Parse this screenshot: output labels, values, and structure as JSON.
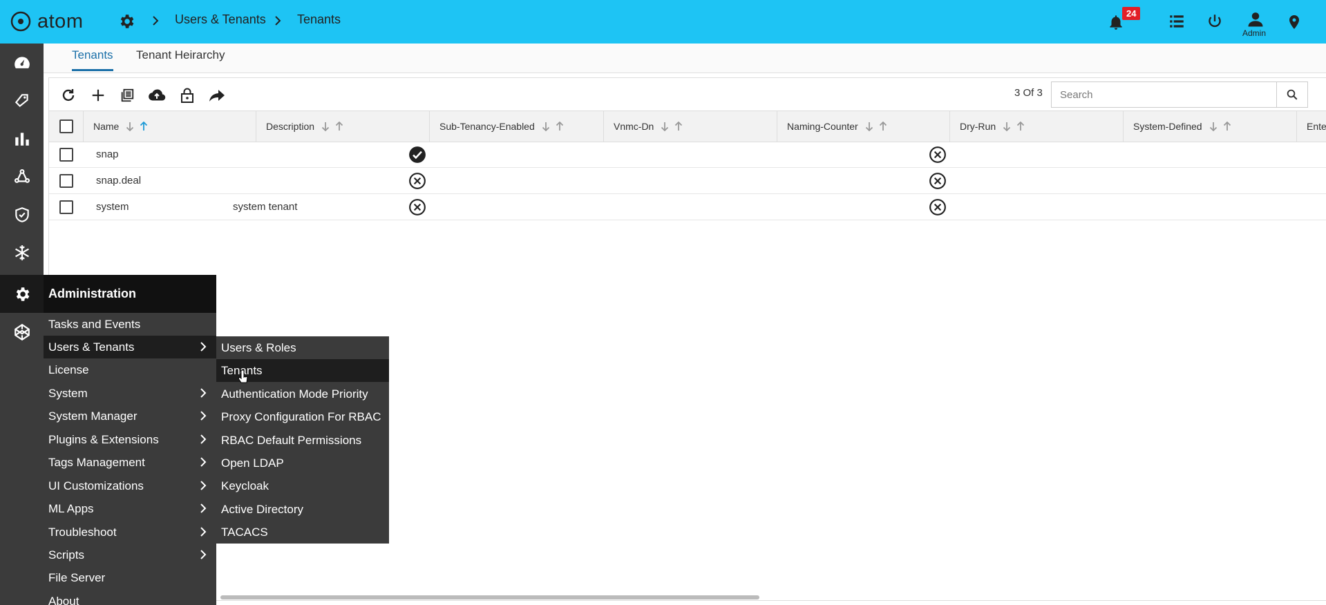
{
  "app": {
    "name": "atom"
  },
  "breadcrumb": {
    "items": [
      "Users & Tenants",
      "Tenants"
    ]
  },
  "header": {
    "notification_count": "24",
    "user_label": "Admin"
  },
  "tabs": [
    {
      "label": "Tenants",
      "active": true
    },
    {
      "label": "Tenant Heirarchy",
      "active": false
    }
  ],
  "toolbar": {
    "icons": [
      "refresh-icon",
      "add-icon",
      "copy-icon",
      "upload-icon",
      "lock-icon",
      "share-icon"
    ],
    "count_label": "3 Of 3",
    "search_placeholder": "Search"
  },
  "table": {
    "columns": [
      "Name",
      "Description",
      "Sub-Tenancy-Enabled",
      "Vnmc-Dn",
      "Naming-Counter",
      "Dry-Run",
      "System-Defined",
      "Enterprise-I"
    ],
    "rows": [
      {
        "name": "snap",
        "description": "",
        "sub_tenancy_enabled": true,
        "dry_run": false
      },
      {
        "name": "snap.deal",
        "description": "",
        "sub_tenancy_enabled": false,
        "dry_run": false
      },
      {
        "name": "system",
        "description": "system tenant",
        "sub_tenancy_enabled": false,
        "dry_run": false
      }
    ]
  },
  "sidebar": {
    "icons": [
      "dashboard-icon",
      "tag-icon",
      "chart-icon",
      "network-icon",
      "shield-icon",
      "snowflake-icon",
      "gear-icon",
      "codepen-icon"
    ]
  },
  "menu": {
    "header": "Administration",
    "items": [
      {
        "label": "Tasks and Events",
        "submenu": false
      },
      {
        "label": "Users & Tenants",
        "submenu": true,
        "highlighted": true
      },
      {
        "label": "License",
        "submenu": false
      },
      {
        "label": "System",
        "submenu": true
      },
      {
        "label": "System Manager",
        "submenu": true
      },
      {
        "label": "Plugins & Extensions",
        "submenu": true
      },
      {
        "label": "Tags Management",
        "submenu": true
      },
      {
        "label": "UI Customizations",
        "submenu": true
      },
      {
        "label": "ML Apps",
        "submenu": true
      },
      {
        "label": "Troubleshoot",
        "submenu": true
      },
      {
        "label": "Scripts",
        "submenu": true
      },
      {
        "label": "File Server",
        "submenu": false
      },
      {
        "label": "About",
        "submenu": false
      }
    ]
  },
  "submenu": {
    "items": [
      {
        "label": "Users & Roles"
      },
      {
        "label": "Tenants",
        "highlighted": true
      },
      {
        "label": "Authentication Mode Priority"
      },
      {
        "label": "Proxy Configuration For RBAC"
      },
      {
        "label": "RBAC Default Permissions"
      },
      {
        "label": "Open LDAP"
      },
      {
        "label": "Keycloak"
      },
      {
        "label": "Active Directory"
      },
      {
        "label": "TACACS"
      }
    ]
  },
  "colors": {
    "topbar": "#1ec4f4",
    "sidebar": "#3b3b3b",
    "accent": "#1a6fa8",
    "badge": "#e21f26"
  }
}
